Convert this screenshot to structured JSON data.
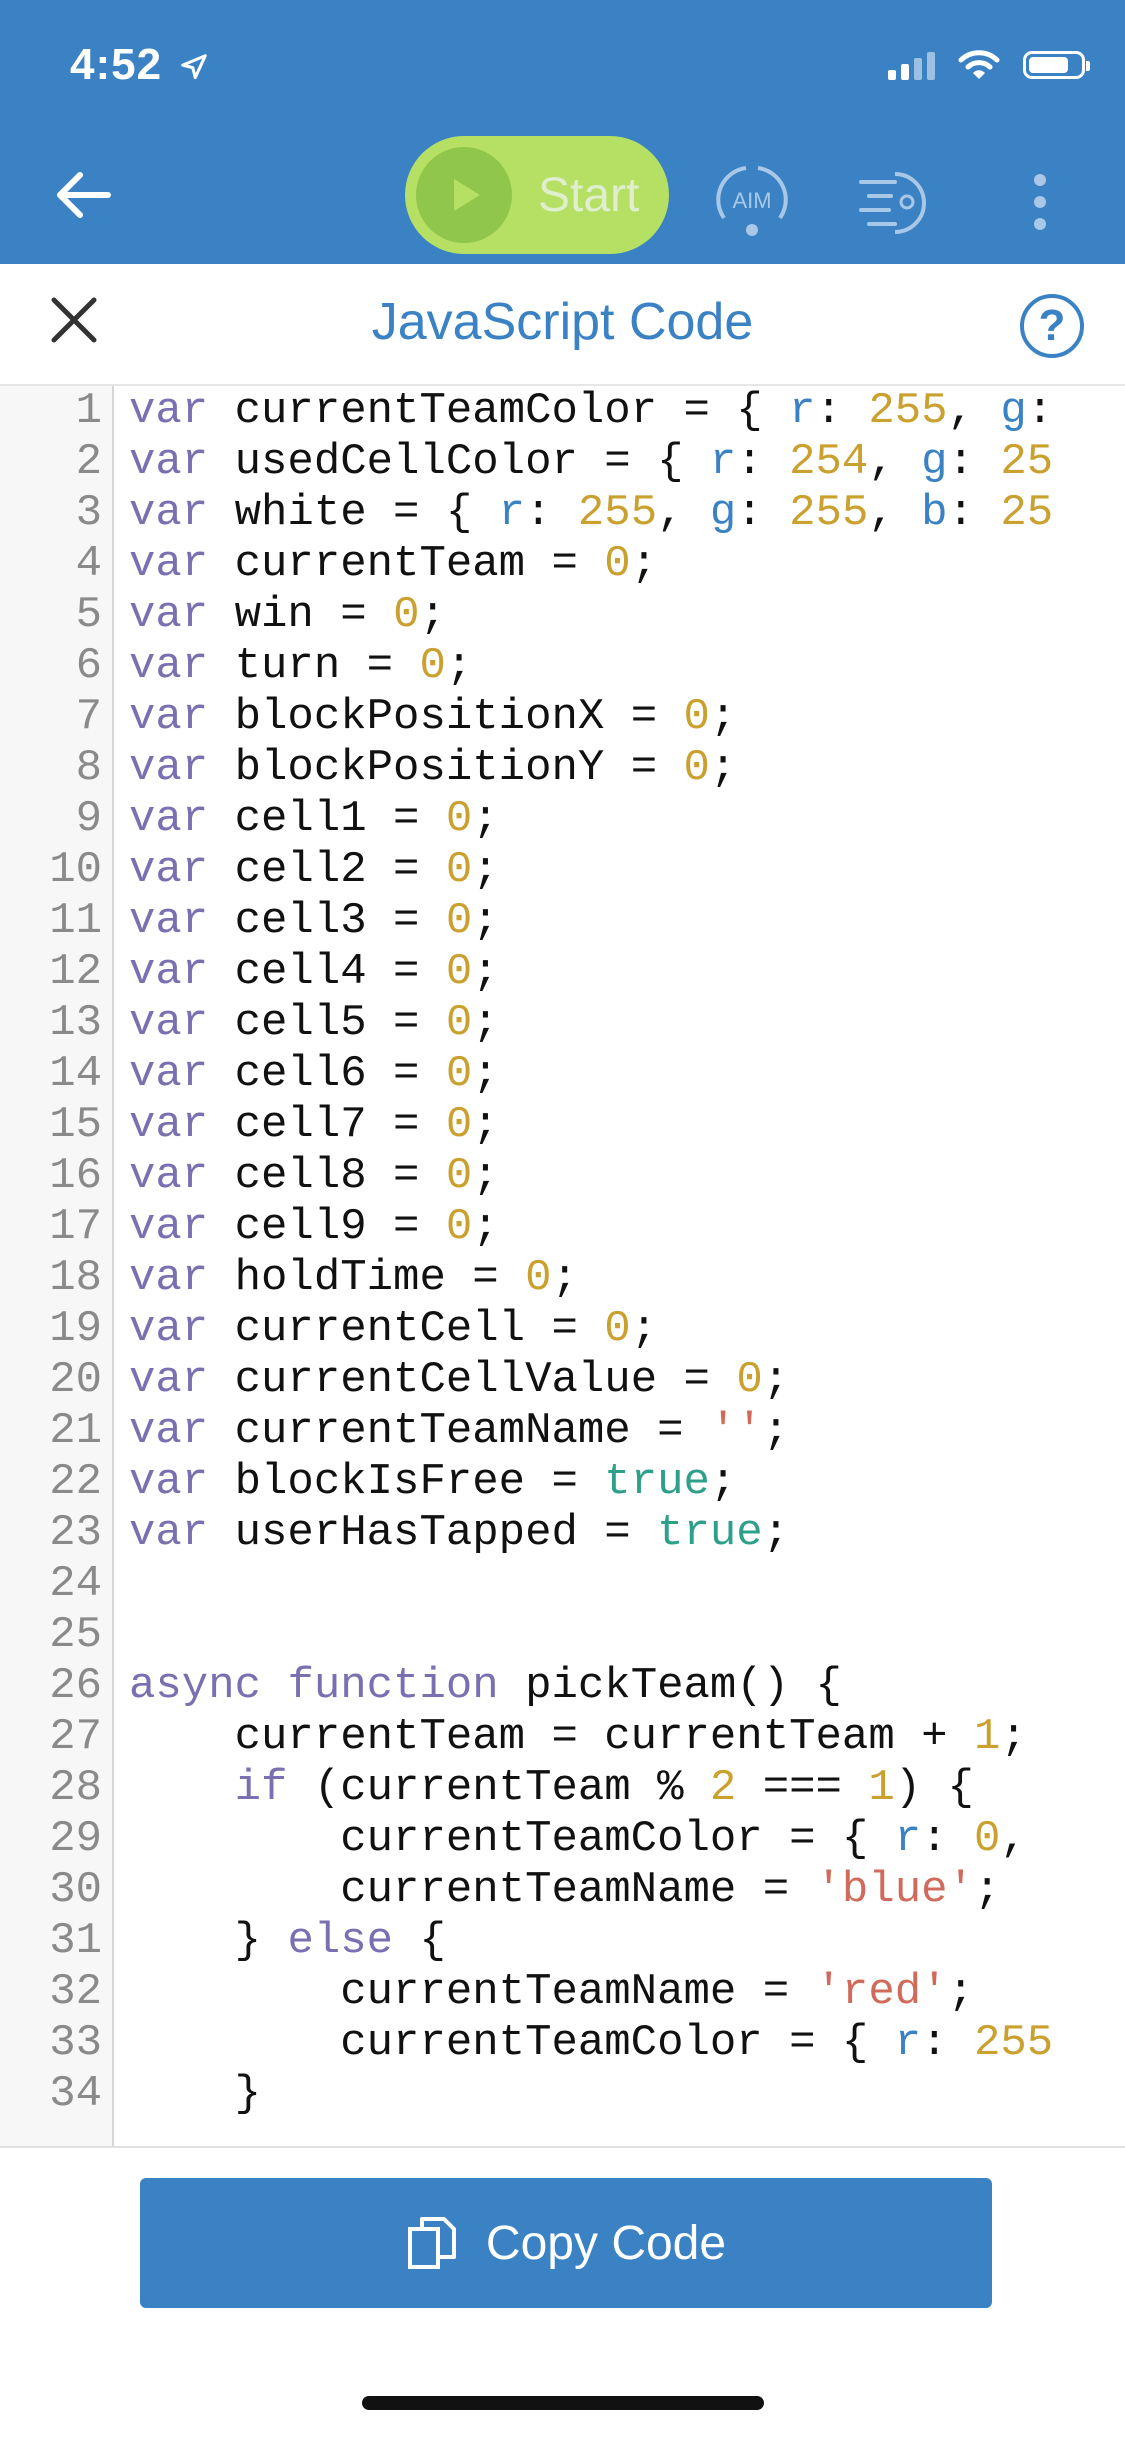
{
  "status_bar": {
    "time": "4:52",
    "location_icon": "location-arrow-icon",
    "signal_icon": "signal-icon",
    "wifi_icon": "wifi-icon",
    "battery_icon": "battery-icon"
  },
  "toolbar": {
    "back_icon": "arrow-left-icon",
    "start_label": "Start",
    "aim_label": "AIM",
    "drive_icon": "drive-mode-icon",
    "more_icon": "more-vertical-icon",
    "colors": {
      "bar": "#3b82c4",
      "start_bg": "#b5e063",
      "start_circle": "#8fc64b"
    }
  },
  "header": {
    "title": "JavaScript Code",
    "close_icon": "close-icon",
    "help_label": "?"
  },
  "code": {
    "lines": [
      {
        "n": "1",
        "tokens": [
          {
            "t": "var",
            "c": "kw"
          },
          {
            "t": " currentTeamColor = { "
          },
          {
            "t": "r",
            "c": "prop"
          },
          {
            "t": ": "
          },
          {
            "t": "255",
            "c": "num"
          },
          {
            "t": ", "
          },
          {
            "t": "g",
            "c": "prop"
          },
          {
            "t": ":"
          }
        ]
      },
      {
        "n": "2",
        "tokens": [
          {
            "t": "var",
            "c": "kw"
          },
          {
            "t": " usedCellColor = { "
          },
          {
            "t": "r",
            "c": "prop"
          },
          {
            "t": ": "
          },
          {
            "t": "254",
            "c": "num"
          },
          {
            "t": ", "
          },
          {
            "t": "g",
            "c": "prop"
          },
          {
            "t": ": "
          },
          {
            "t": "25",
            "c": "num"
          }
        ]
      },
      {
        "n": "3",
        "tokens": [
          {
            "t": "var",
            "c": "kw"
          },
          {
            "t": " white = { "
          },
          {
            "t": "r",
            "c": "prop"
          },
          {
            "t": ": "
          },
          {
            "t": "255",
            "c": "num"
          },
          {
            "t": ", "
          },
          {
            "t": "g",
            "c": "prop"
          },
          {
            "t": ": "
          },
          {
            "t": "255",
            "c": "num"
          },
          {
            "t": ", "
          },
          {
            "t": "b",
            "c": "prop"
          },
          {
            "t": ": "
          },
          {
            "t": "25",
            "c": "num"
          }
        ]
      },
      {
        "n": "4",
        "tokens": [
          {
            "t": "var",
            "c": "kw"
          },
          {
            "t": " currentTeam = "
          },
          {
            "t": "0",
            "c": "num"
          },
          {
            "t": ";"
          }
        ]
      },
      {
        "n": "5",
        "tokens": [
          {
            "t": "var",
            "c": "kw"
          },
          {
            "t": " win = "
          },
          {
            "t": "0",
            "c": "num"
          },
          {
            "t": ";"
          }
        ]
      },
      {
        "n": "6",
        "tokens": [
          {
            "t": "var",
            "c": "kw"
          },
          {
            "t": " turn = "
          },
          {
            "t": "0",
            "c": "num"
          },
          {
            "t": ";"
          }
        ]
      },
      {
        "n": "7",
        "tokens": [
          {
            "t": "var",
            "c": "kw"
          },
          {
            "t": " blockPositionX = "
          },
          {
            "t": "0",
            "c": "num"
          },
          {
            "t": ";"
          }
        ]
      },
      {
        "n": "8",
        "tokens": [
          {
            "t": "var",
            "c": "kw"
          },
          {
            "t": " blockPositionY = "
          },
          {
            "t": "0",
            "c": "num"
          },
          {
            "t": ";"
          }
        ]
      },
      {
        "n": "9",
        "tokens": [
          {
            "t": "var",
            "c": "kw"
          },
          {
            "t": " cell1 = "
          },
          {
            "t": "0",
            "c": "num"
          },
          {
            "t": ";"
          }
        ]
      },
      {
        "n": "10",
        "tokens": [
          {
            "t": "var",
            "c": "kw"
          },
          {
            "t": " cell2 = "
          },
          {
            "t": "0",
            "c": "num"
          },
          {
            "t": ";"
          }
        ]
      },
      {
        "n": "11",
        "tokens": [
          {
            "t": "var",
            "c": "kw"
          },
          {
            "t": " cell3 = "
          },
          {
            "t": "0",
            "c": "num"
          },
          {
            "t": ";"
          }
        ]
      },
      {
        "n": "12",
        "tokens": [
          {
            "t": "var",
            "c": "kw"
          },
          {
            "t": " cell4 = "
          },
          {
            "t": "0",
            "c": "num"
          },
          {
            "t": ";"
          }
        ]
      },
      {
        "n": "13",
        "tokens": [
          {
            "t": "var",
            "c": "kw"
          },
          {
            "t": " cell5 = "
          },
          {
            "t": "0",
            "c": "num"
          },
          {
            "t": ";"
          }
        ]
      },
      {
        "n": "14",
        "tokens": [
          {
            "t": "var",
            "c": "kw"
          },
          {
            "t": " cell6 = "
          },
          {
            "t": "0",
            "c": "num"
          },
          {
            "t": ";"
          }
        ]
      },
      {
        "n": "15",
        "tokens": [
          {
            "t": "var",
            "c": "kw"
          },
          {
            "t": " cell7 = "
          },
          {
            "t": "0",
            "c": "num"
          },
          {
            "t": ";"
          }
        ]
      },
      {
        "n": "16",
        "tokens": [
          {
            "t": "var",
            "c": "kw"
          },
          {
            "t": " cell8 = "
          },
          {
            "t": "0",
            "c": "num"
          },
          {
            "t": ";"
          }
        ]
      },
      {
        "n": "17",
        "tokens": [
          {
            "t": "var",
            "c": "kw"
          },
          {
            "t": " cell9 = "
          },
          {
            "t": "0",
            "c": "num"
          },
          {
            "t": ";"
          }
        ]
      },
      {
        "n": "18",
        "tokens": [
          {
            "t": "var",
            "c": "kw"
          },
          {
            "t": " holdTime = "
          },
          {
            "t": "0",
            "c": "num"
          },
          {
            "t": ";"
          }
        ]
      },
      {
        "n": "19",
        "tokens": [
          {
            "t": "var",
            "c": "kw"
          },
          {
            "t": " currentCell = "
          },
          {
            "t": "0",
            "c": "num"
          },
          {
            "t": ";"
          }
        ]
      },
      {
        "n": "20",
        "tokens": [
          {
            "t": "var",
            "c": "kw"
          },
          {
            "t": " currentCellValue = "
          },
          {
            "t": "0",
            "c": "num"
          },
          {
            "t": ";"
          }
        ]
      },
      {
        "n": "21",
        "tokens": [
          {
            "t": "var",
            "c": "kw"
          },
          {
            "t": " currentTeamName = "
          },
          {
            "t": "''",
            "c": "str"
          },
          {
            "t": ";"
          }
        ]
      },
      {
        "n": "22",
        "tokens": [
          {
            "t": "var",
            "c": "kw"
          },
          {
            "t": " blockIsFree = "
          },
          {
            "t": "true",
            "c": "bool"
          },
          {
            "t": ";"
          }
        ]
      },
      {
        "n": "23",
        "tokens": [
          {
            "t": "var",
            "c": "kw"
          },
          {
            "t": " userHasTapped = "
          },
          {
            "t": "true",
            "c": "bool"
          },
          {
            "t": ";"
          }
        ]
      },
      {
        "n": "24",
        "tokens": []
      },
      {
        "n": "25",
        "tokens": []
      },
      {
        "n": "26",
        "tokens": [
          {
            "t": "async",
            "c": "kw"
          },
          {
            "t": " "
          },
          {
            "t": "function",
            "c": "kw"
          },
          {
            "t": " pickTeam() {"
          }
        ]
      },
      {
        "n": "27",
        "tokens": [
          {
            "t": "    currentTeam = currentTeam + "
          },
          {
            "t": "1",
            "c": "num"
          },
          {
            "t": ";"
          }
        ]
      },
      {
        "n": "28",
        "tokens": [
          {
            "t": "    "
          },
          {
            "t": "if",
            "c": "kw"
          },
          {
            "t": " (currentTeam % "
          },
          {
            "t": "2",
            "c": "num"
          },
          {
            "t": " === "
          },
          {
            "t": "1",
            "c": "num"
          },
          {
            "t": ") {"
          }
        ]
      },
      {
        "n": "29",
        "tokens": [
          {
            "t": "        currentTeamColor = { "
          },
          {
            "t": "r",
            "c": "prop"
          },
          {
            "t": ": "
          },
          {
            "t": "0",
            "c": "num"
          },
          {
            "t": ","
          }
        ]
      },
      {
        "n": "30",
        "tokens": [
          {
            "t": "        currentTeamName = "
          },
          {
            "t": "'blue'",
            "c": "str"
          },
          {
            "t": ";"
          }
        ]
      },
      {
        "n": "31",
        "tokens": [
          {
            "t": "    } "
          },
          {
            "t": "else",
            "c": "kw"
          },
          {
            "t": " {"
          }
        ]
      },
      {
        "n": "32",
        "tokens": [
          {
            "t": "        currentTeamName = "
          },
          {
            "t": "'red'",
            "c": "str"
          },
          {
            "t": ";"
          }
        ]
      },
      {
        "n": "33",
        "tokens": [
          {
            "t": "        currentTeamColor = { "
          },
          {
            "t": "r",
            "c": "prop"
          },
          {
            "t": ": "
          },
          {
            "t": "255",
            "c": "num"
          }
        ]
      },
      {
        "n": "34",
        "tokens": [
          {
            "t": "    }"
          }
        ]
      }
    ]
  },
  "footer": {
    "copy_label": "Copy Code",
    "copy_icon": "copy-icon"
  }
}
